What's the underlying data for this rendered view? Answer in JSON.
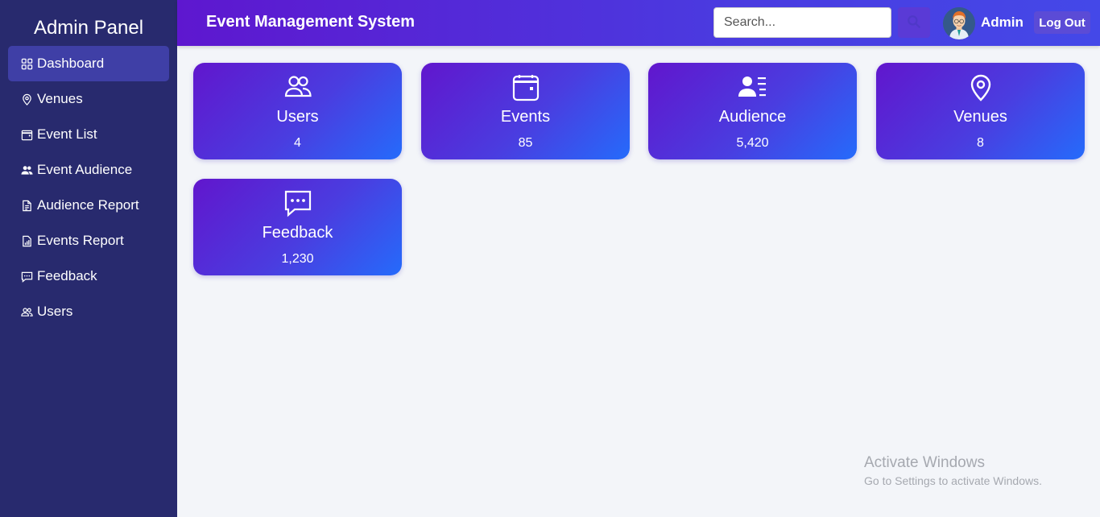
{
  "sidebar": {
    "title": "Admin Panel",
    "items": [
      {
        "label": "Dashboard",
        "icon": "grid-icon",
        "active": true
      },
      {
        "label": "Venues",
        "icon": "location-pin-icon"
      },
      {
        "label": "Event List",
        "icon": "calendar-icon"
      },
      {
        "label": "Event Audience",
        "icon": "people-icon"
      },
      {
        "label": "Audience Report",
        "icon": "document-icon"
      },
      {
        "label": "Events Report",
        "icon": "bar-chart-icon"
      },
      {
        "label": "Feedback",
        "icon": "chat-dots-icon"
      },
      {
        "label": "Users",
        "icon": "people-outline-icon"
      }
    ]
  },
  "header": {
    "title": "Event Management System",
    "search_placeholder": "Search...",
    "search_value": "",
    "user_name": "Admin",
    "logout_label": "Log Out"
  },
  "cards": [
    {
      "label": "Users",
      "value": "4",
      "icon": "people-icon"
    },
    {
      "label": "Events",
      "value": "85",
      "icon": "calendar-icon"
    },
    {
      "label": "Audience",
      "value": "5,420",
      "icon": "person-lines-icon"
    },
    {
      "label": "Venues",
      "value": "8",
      "icon": "location-pin-icon"
    },
    {
      "label": "Feedback",
      "value": "1,230",
      "icon": "chat-dots-icon"
    }
  ],
  "watermark": {
    "line1": "Activate Windows",
    "line2": "Go to Settings to activate Windows."
  },
  "colors": {
    "sidebar_bg": "#282a6e",
    "sidebar_active": "#3f3fa6",
    "header_gradient_start": "#5e17cf",
    "header_gradient_end": "#4448e8",
    "card_gradient_start": "#6116cd",
    "card_gradient_end": "#256bfb",
    "page_bg": "#f3f5f9"
  }
}
